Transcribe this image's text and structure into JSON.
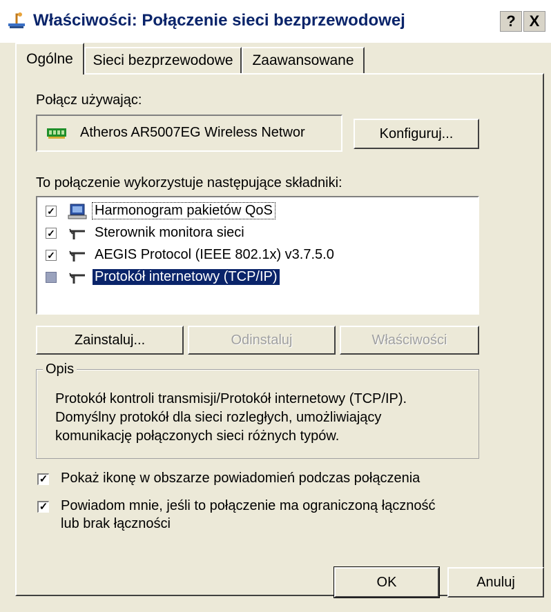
{
  "window": {
    "title": "Właściwości: Połączenie sieci bezprzewodowej",
    "help_button": "?",
    "close_button": "X"
  },
  "tabs": [
    {
      "label": "Ogólne",
      "active": true
    },
    {
      "label": "Sieci bezprzewodowe",
      "active": false
    },
    {
      "label": "Zaawansowane",
      "active": false
    }
  ],
  "connect_using": {
    "label": "Połącz używając:",
    "adapter": "Atheros AR5007EG Wireless Networ",
    "adapter_icon": "network-card-icon",
    "configure_button": "Konfiguruj..."
  },
  "components": {
    "label": "To połączenie wykorzystuje następujące składniki:",
    "items": [
      {
        "label": "Harmonogram pakietów QoS",
        "checked": true,
        "icon": "qos-scheduler-icon"
      },
      {
        "label": "Sterownik monitora sieci",
        "checked": true,
        "icon": "network-protocol-icon"
      },
      {
        "label": "AEGIS Protocol (IEEE 802.1x) v3.7.5.0",
        "checked": true,
        "icon": "network-protocol-icon"
      },
      {
        "label": "Protokół internetowy (TCP/IP)",
        "checked": false,
        "icon": "network-protocol-icon"
      }
    ]
  },
  "buttons": {
    "install": "Zainstaluj...",
    "uninstall": "Odinstaluj",
    "properties": "Właściwości",
    "ok": "OK",
    "cancel": "Anuluj"
  },
  "description": {
    "legend": "Opis",
    "lines": [
      "Protokół kontroli transmisji/Protokół internetowy (TCP/IP).",
      "Domyślny protokół dla sieci rozległych, umożliwiający",
      "komunikację połączonych sieci różnych typów."
    ]
  },
  "options": [
    {
      "lines": [
        "Pokaż ikonę w obszarze powiadomień podczas połączenia"
      ],
      "checked": true
    },
    {
      "lines": [
        "Powiadom mnie, jeśli to połączenie ma ograniczoną łączność",
        "lub brak łączności"
      ],
      "checked": true
    }
  ],
  "colors": {
    "dialog_bg": "#ece9d8",
    "selection_bg": "#0a246a",
    "title_text": "#0a246a"
  }
}
